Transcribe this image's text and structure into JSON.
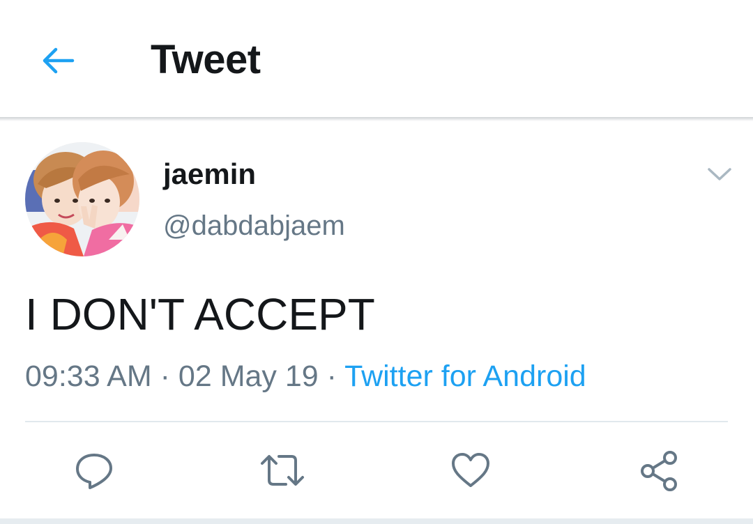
{
  "header": {
    "title": "Tweet",
    "back_icon": "arrow-left-icon"
  },
  "tweet": {
    "author": {
      "display_name": "jaemin",
      "handle": "@dabdabjaem",
      "avatar": "profile-photo"
    },
    "text": "I DON'T ACCEPT",
    "time": "09:33 AM",
    "date": "02 May 19",
    "separator": "·",
    "source": "Twitter for Android",
    "menu_icon": "chevron-down-icon"
  },
  "actions": [
    {
      "name": "reply",
      "icon": "reply-icon"
    },
    {
      "name": "retweet",
      "icon": "retweet-icon"
    },
    {
      "name": "like",
      "icon": "heart-icon"
    },
    {
      "name": "share",
      "icon": "share-icon"
    }
  ],
  "colors": {
    "accent": "#1da1f2",
    "text_primary": "#14171a",
    "text_secondary": "#657786",
    "divider": "#e1e8ed"
  }
}
